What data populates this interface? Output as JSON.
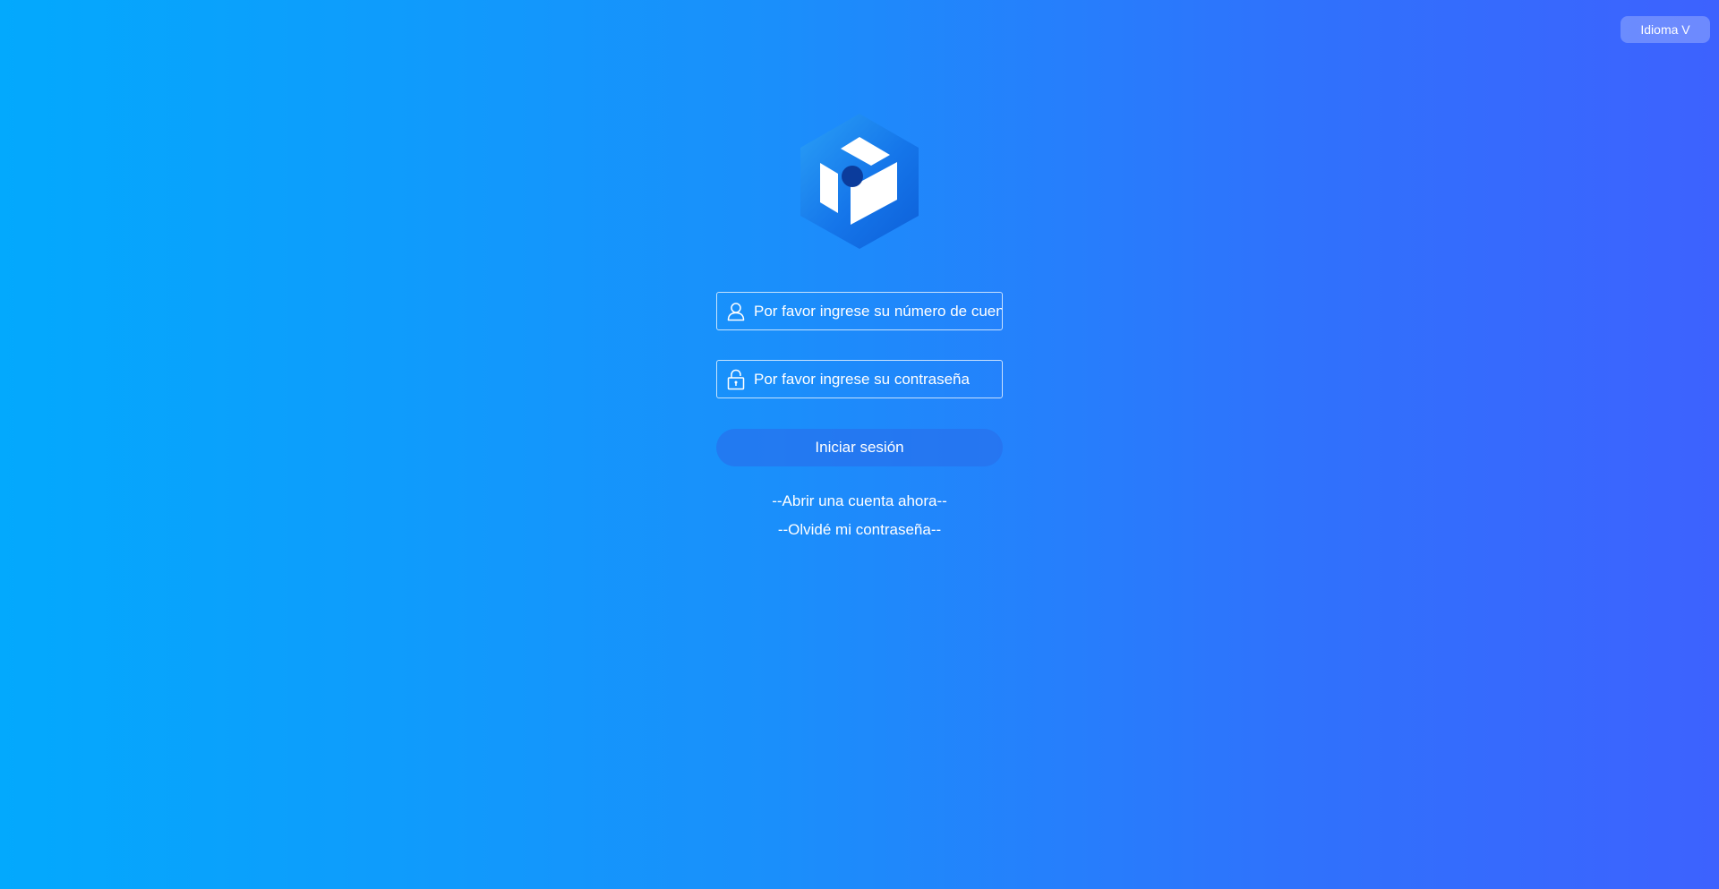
{
  "header": {
    "language_label": "Idioma V"
  },
  "login_form": {
    "account_placeholder": "Por favor ingrese su número de cuenta",
    "password_placeholder": "Por favor ingrese su contraseña",
    "login_label": "Iniciar sesión",
    "open_account_label": "--Abrir una cuenta ahora--",
    "forgot_password_label": "--Olvidé mi contraseña--"
  },
  "icons": {
    "account": "user-icon",
    "password": "lock-icon",
    "logo": "hexagon-cube-logo"
  },
  "colors": {
    "background_start": "#03a9fd",
    "background_end": "#3d62fe",
    "logo_blue": "#1976f0",
    "logo_dark": "#0b3c9c"
  }
}
